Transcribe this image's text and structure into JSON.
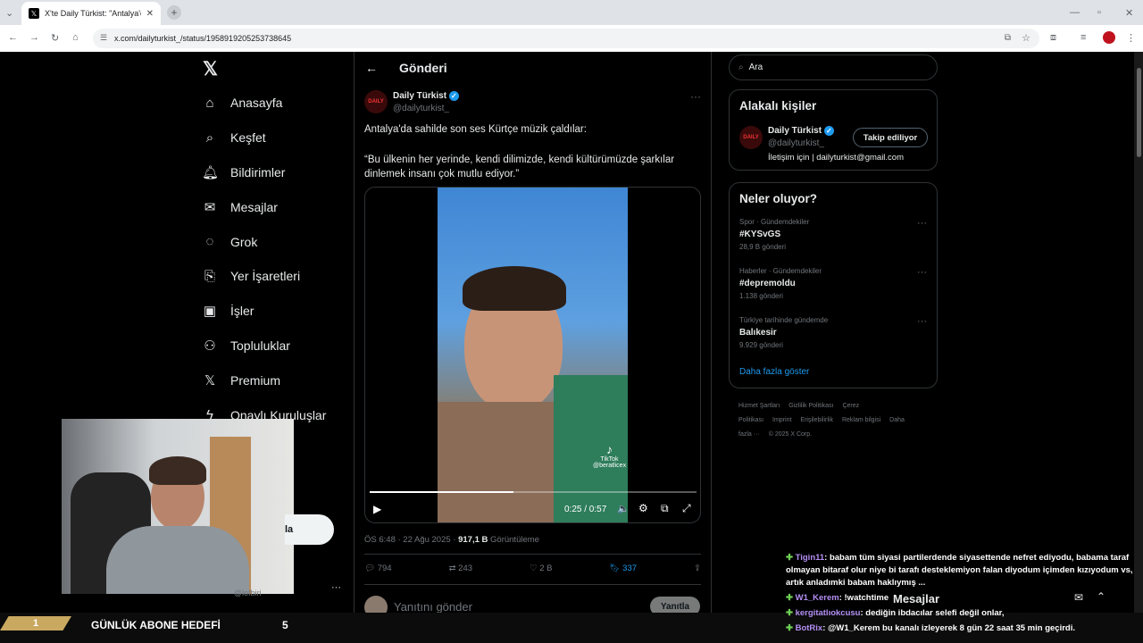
{
  "browser": {
    "tab_title": "X'te Daily Türkist: \"Antalya'da sa",
    "url": "x.com/dailyturkist_/status/1958919205253738645"
  },
  "nav": {
    "items": [
      {
        "label": "Anasayfa",
        "icon": "home-icon"
      },
      {
        "label": "Keşfet",
        "icon": "search-icon"
      },
      {
        "label": "Bildirimler",
        "icon": "bell-icon"
      },
      {
        "label": "Mesajlar",
        "icon": "mail-icon"
      },
      {
        "label": "Grok",
        "icon": "grok-icon"
      },
      {
        "label": "Yer İşaretleri",
        "icon": "bookmark-icon"
      },
      {
        "label": "İşler",
        "icon": "briefcase-icon"
      },
      {
        "label": "Topluluklar",
        "icon": "people-icon"
      },
      {
        "label": "Premium",
        "icon": "x-logo-icon"
      },
      {
        "label": "Onaylı Kuruluşlar",
        "icon": "bolt-icon"
      }
    ],
    "post_button_label": "la",
    "account_handle": "@lofbiri"
  },
  "post": {
    "header_title": "Gönderi",
    "author_name": "Daily Türkist",
    "author_handle": "@dailyturkist_",
    "text_line1": "Antalya'da sahilde son ses Kürtçe müzik çaldılar:",
    "text_line2": "“Bu ülkenin her yerinde, kendi dilimizde, kendi kültürümüzde şarkılar dinlemek insanı çok mutlu ediyor.”",
    "video_time": "0:25 / 0:57",
    "video_progress": 0.44,
    "tiktok_label": "TikTok",
    "tiktok_user": "@beratlicex",
    "timestamp": "ÖS 6:48 · 22 Ağu 2025 ·",
    "views_count": "917,1 B",
    "views_label": "Görüntüleme",
    "replies": "794",
    "reposts": "243",
    "likes": "2 B",
    "bookmarks": "337",
    "reply_placeholder": "Yanıtını gönder",
    "reply_button": "Yanıtla"
  },
  "sidebar": {
    "search_placeholder": "Ara",
    "relevant_title": "Alakalı kişiler",
    "relevant_name": "Daily Türkist",
    "relevant_handle": "@dailyturkist_",
    "relevant_bio": "İletişim için | dailyturkist@gmail.com",
    "follow_button": "Takip ediliyor",
    "trends_title": "Neler oluyor?",
    "trends": [
      {
        "category": "Spor · Gündemdekiler",
        "name": "#KYSvGS",
        "count": "28,9 B gönderi"
      },
      {
        "category": "Haberler · Gündemdekiler",
        "name": "#depremoldu",
        "count": "1.138 gönderi"
      },
      {
        "category": "Türkiye tarihinde gündemde",
        "name": "Balıkesir",
        "count": "9.929 gönderi"
      }
    ],
    "show_more": "Daha fazla göster",
    "footer_links": [
      "Hizmet Şartları",
      "Gizlilik Politikası",
      "Çerez Politikası",
      "Imprint",
      "Erişilebilirlik",
      "Reklam bilgisi",
      "Daha fazla ···",
      "© 2025 X Corp."
    ]
  },
  "overlay": {
    "goal_count_left": "1",
    "goal_label": "GÜNLÜK ABONE HEDEFİ",
    "goal_count_right": "5",
    "messages_label": "Mesajlar",
    "chat": [
      {
        "user": "Tigin11",
        "text": ": babam tüm siyasi partilerdende siyasettende nefret ediyodu, babama taraf olmayan bitaraf olur niye bi tarafı desteklemiyon falan diyodum içimden kızıyodum vs, artık anladımki babam haklıymış ..."
      },
      {
        "user": "W1_Kerem",
        "text": ": !watchtime"
      },
      {
        "user": "kergitatlıokcusu",
        "text": ": dediğin ibdacılar selefi değil onlar,"
      },
      {
        "user": "BotRix",
        "text": ": @W1_Kerem bu kanalı izleyerek 8 gün 22 saat 35 min geçirdi."
      }
    ]
  }
}
